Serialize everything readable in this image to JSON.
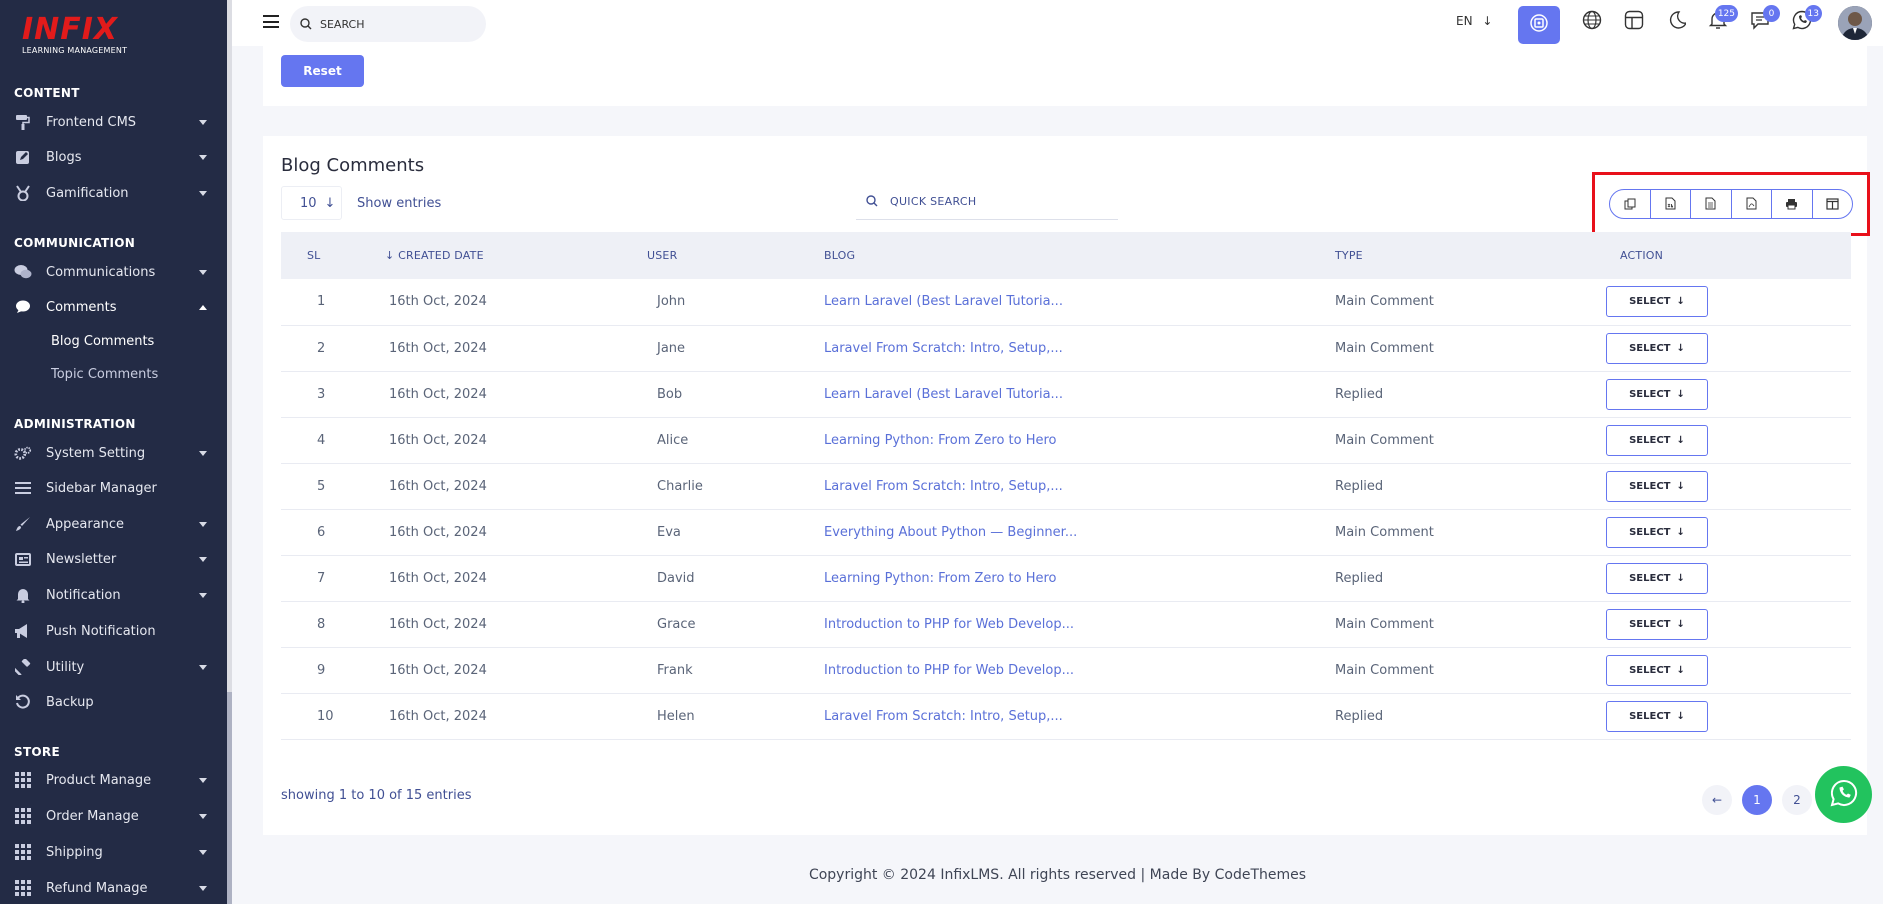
{
  "app": {
    "logo_text": "INFIX",
    "logo_tagline": "LEARNING MANAGEMENT"
  },
  "sidebar": {
    "sections": [
      {
        "title": "CONTENT",
        "items": [
          {
            "label": "Frontend CMS",
            "icon": "paint-roller-icon",
            "has_caret": true
          },
          {
            "label": "Blogs",
            "icon": "edit-square-icon",
            "has_caret": true
          },
          {
            "label": "Gamification",
            "icon": "medal-icon",
            "has_caret": true
          }
        ]
      },
      {
        "title": "COMMUNICATION",
        "items": [
          {
            "label": "Communications",
            "icon": "chat-bubbles-icon",
            "has_caret": true
          },
          {
            "label": "Comments",
            "icon": "comment-icon",
            "has_caret": true,
            "expanded": true,
            "subitems": [
              {
                "label": "Blog Comments",
                "active": true
              },
              {
                "label": "Topic Comments"
              }
            ]
          }
        ]
      },
      {
        "title": "ADMINISTRATION",
        "items": [
          {
            "label": "System Setting",
            "icon": "gears-icon",
            "has_caret": true
          },
          {
            "label": "Sidebar Manager",
            "icon": "bars-icon",
            "has_caret": false
          },
          {
            "label": "Appearance",
            "icon": "brush-icon",
            "has_caret": true
          },
          {
            "label": "Newsletter",
            "icon": "newsletter-icon",
            "has_caret": true
          },
          {
            "label": "Notification",
            "icon": "bell-icon",
            "has_caret": true
          },
          {
            "label": "Push Notification",
            "icon": "megaphone-icon",
            "has_caret": false
          },
          {
            "label": "Utility",
            "icon": "hammer-icon",
            "has_caret": true
          },
          {
            "label": "Backup",
            "icon": "history-icon",
            "has_caret": false
          }
        ]
      },
      {
        "title": "STORE",
        "items": [
          {
            "label": "Product Manage",
            "icon": "grid-icon",
            "has_caret": true
          },
          {
            "label": "Order Manage",
            "icon": "grid-icon",
            "has_caret": true
          },
          {
            "label": "Shipping",
            "icon": "grid-icon",
            "has_caret": true
          },
          {
            "label": "Refund Manage",
            "icon": "grid-icon",
            "has_caret": true
          }
        ]
      }
    ]
  },
  "header": {
    "search_placeholder": "SEARCH",
    "language": "EN",
    "notifications_count": "125",
    "messages_count": "0",
    "whatsapp_count": "13"
  },
  "filters": {
    "reset_label": "Reset"
  },
  "table_card": {
    "title": "Blog Comments",
    "entries_value": "10",
    "entries_label": "Show entries",
    "quick_search_placeholder": "QUICK SEARCH",
    "export_buttons": [
      "copy-icon",
      "csv-file-icon",
      "excel-file-icon",
      "pdf-file-icon",
      "print-icon",
      "columns-icon"
    ],
    "columns": [
      "SL",
      "CREATED DATE",
      "USER",
      "BLOG",
      "TYPE",
      "ACTION"
    ],
    "rows": [
      {
        "sl": "1",
        "date": "16th Oct, 2024",
        "user": "John",
        "blog": "Learn Laravel (Best Laravel Tutoria...",
        "type": "Main Comment",
        "action": "SELECT"
      },
      {
        "sl": "2",
        "date": "16th Oct, 2024",
        "user": "Jane",
        "blog": "Laravel From Scratch: Intro, Setup,...",
        "type": "Main Comment",
        "action": "SELECT"
      },
      {
        "sl": "3",
        "date": "16th Oct, 2024",
        "user": "Bob",
        "blog": "Learn Laravel (Best Laravel Tutoria...",
        "type": "Replied",
        "action": "SELECT"
      },
      {
        "sl": "4",
        "date": "16th Oct, 2024",
        "user": "Alice",
        "blog": "Learning Python: From Zero to Hero",
        "type": "Main Comment",
        "action": "SELECT"
      },
      {
        "sl": "5",
        "date": "16th Oct, 2024",
        "user": "Charlie",
        "blog": "Laravel From Scratch: Intro, Setup,...",
        "type": "Replied",
        "action": "SELECT"
      },
      {
        "sl": "6",
        "date": "16th Oct, 2024",
        "user": "Eva",
        "blog": "Everything About Python — Beginner...",
        "type": "Main Comment",
        "action": "SELECT"
      },
      {
        "sl": "7",
        "date": "16th Oct, 2024",
        "user": "David",
        "blog": "Learning Python: From Zero to Hero",
        "type": "Replied",
        "action": "SELECT"
      },
      {
        "sl": "8",
        "date": "16th Oct, 2024",
        "user": "Grace",
        "blog": "Introduction to PHP for Web Develop...",
        "type": "Main Comment",
        "action": "SELECT"
      },
      {
        "sl": "9",
        "date": "16th Oct, 2024",
        "user": "Frank",
        "blog": "Introduction to PHP for Web Develop...",
        "type": "Main Comment",
        "action": "SELECT"
      },
      {
        "sl": "10",
        "date": "16th Oct, 2024",
        "user": "Helen",
        "blog": "Laravel From Scratch: Intro, Setup,...",
        "type": "Replied",
        "action": "SELECT"
      }
    ],
    "showing_text": "showing 1 to 10 of 15 entries",
    "pages": [
      "1",
      "2"
    ],
    "current_page": "1"
  },
  "footer": {
    "text": "Copyright © 2024 InfixLMS. All rights reserved | Made By CodeThemes"
  },
  "colors": {
    "accent": "#6576f0",
    "sidebar_bg": "#232b45",
    "brand_red": "#e21b1b",
    "highlight_red": "#e8101a",
    "whatsapp_green": "#22c35e"
  }
}
